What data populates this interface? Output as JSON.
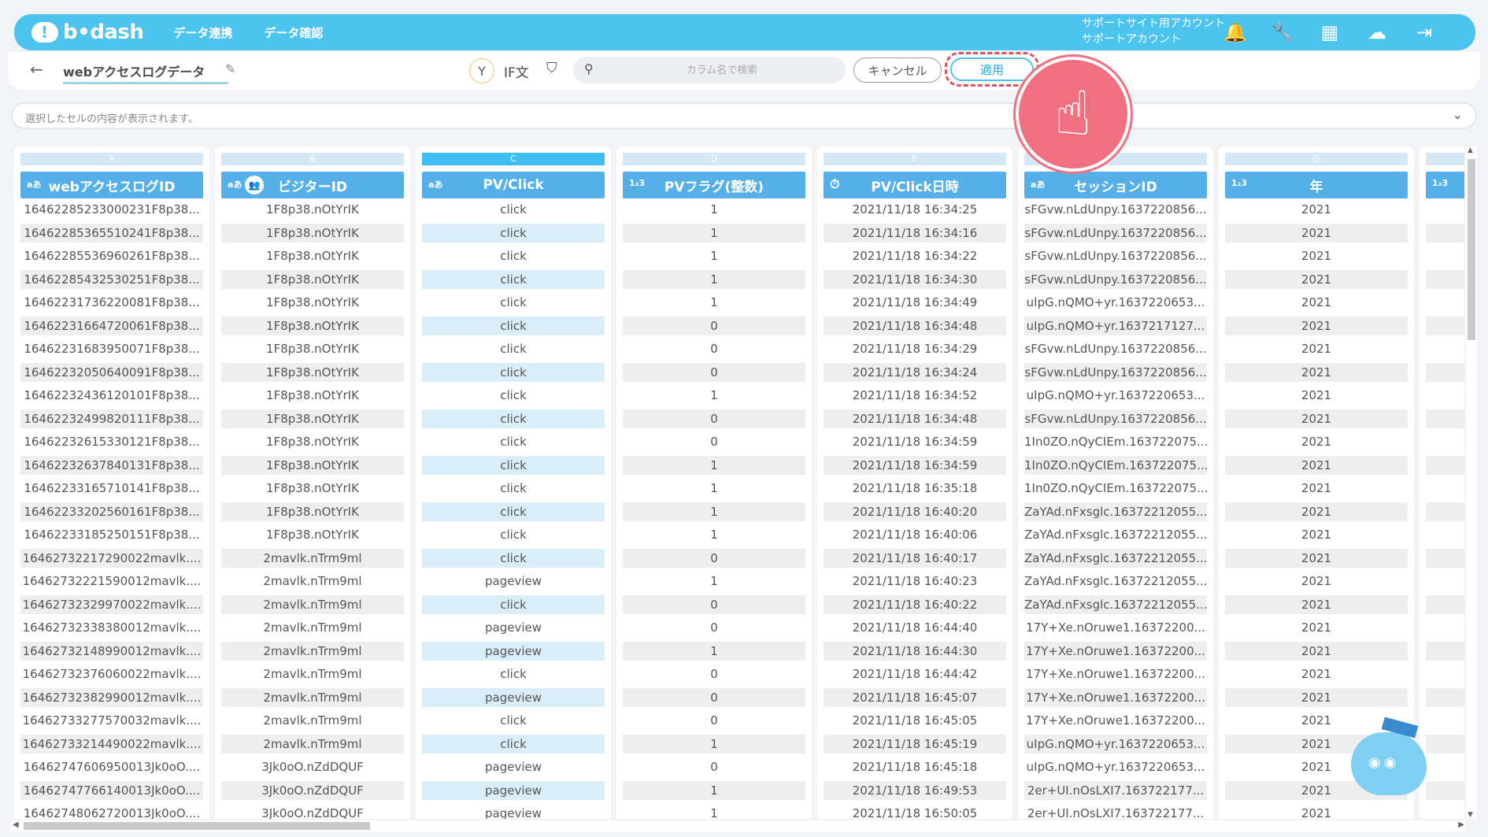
{
  "header": {
    "logo_text": "b•dash",
    "nav": [
      "データ連携",
      "データ確認"
    ],
    "account_line1": "サポートサイト用アカウント",
    "account_line2": "サポートアカウント",
    "icons": [
      "bell-icon",
      "wrench-icon",
      "grid-icon",
      "chat-mascot-icon",
      "logout-icon"
    ]
  },
  "toolbar": {
    "back": "←",
    "table_name": "webアクセスログデータ",
    "if_label": "IF文",
    "search_placeholder": "カラム名で検索",
    "cancel_label": "キャンセル",
    "apply_label": "適用"
  },
  "cell_content": {
    "placeholder": "選択したセルの内容が表示されます。"
  },
  "columns": [
    {
      "letter": "A",
      "name": "webアクセスログID",
      "type": "aあ",
      "user_icon": false
    },
    {
      "letter": "B",
      "name": "ビジターID",
      "type": "aあ",
      "user_icon": true
    },
    {
      "letter": "C",
      "name": "PV/Click",
      "type": "aあ",
      "user_icon": false,
      "active": true
    },
    {
      "letter": "D",
      "name": "PVフラグ(整数)",
      "type": "1₂3",
      "user_icon": false
    },
    {
      "letter": "E",
      "name": "PV/Click日時",
      "type": "⏱",
      "user_icon": false
    },
    {
      "letter": "F",
      "name": "セッションID",
      "type": "aあ",
      "user_icon": false
    },
    {
      "letter": "G",
      "name": "年",
      "type": "1₂3",
      "user_icon": false
    },
    {
      "letter": "",
      "name": "",
      "type": "1₂3",
      "user_icon": false
    }
  ],
  "rows": [
    [
      "16462285233000231F8p38...",
      "1F8p38.nOtYrIK",
      "click",
      "1",
      "2021/11/18 16:34:25",
      "sFGvw.nLdUnpy.1637220856...",
      "2021"
    ],
    [
      "16462285365510241F8p38...",
      "1F8p38.nOtYrIK",
      "click",
      "1",
      "2021/11/18 16:34:16",
      "sFGvw.nLdUnpy.1637220856...",
      "2021"
    ],
    [
      "16462285536960261F8p38...",
      "1F8p38.nOtYrIK",
      "click",
      "1",
      "2021/11/18 16:34:22",
      "sFGvw.nLdUnpy.1637220856...",
      "2021"
    ],
    [
      "16462285432530251F8p38...",
      "1F8p38.nOtYrIK",
      "click",
      "1",
      "2021/11/18 16:34:30",
      "sFGvw.nLdUnpy.1637220856...",
      "2021"
    ],
    [
      "16462231736220081F8p38...",
      "1F8p38.nOtYrIK",
      "click",
      "1",
      "2021/11/18 16:34:49",
      "uIpG.nQMO+yr.1637220653...",
      "2021"
    ],
    [
      "16462231664720061F8p38...",
      "1F8p38.nOtYrIK",
      "click",
      "0",
      "2021/11/18 16:34:48",
      "uIpG.nQMO+yr.1637217127...",
      "2021"
    ],
    [
      "16462231683950071F8p38...",
      "1F8p38.nOtYrIK",
      "click",
      "0",
      "2021/11/18 16:34:29",
      "sFGvw.nLdUnpy.1637220856...",
      "2021"
    ],
    [
      "16462232050640091F8p38...",
      "1F8p38.nOtYrIK",
      "click",
      "0",
      "2021/11/18 16:34:24",
      "sFGvw.nLdUnpy.1637220856...",
      "2021"
    ],
    [
      "16462232436120101F8p38...",
      "1F8p38.nOtYrIK",
      "click",
      "1",
      "2021/11/18 16:34:52",
      "uIpG.nQMO+yr.1637220653...",
      "2021"
    ],
    [
      "16462232499820111F8p38...",
      "1F8p38.nOtYrIK",
      "click",
      "0",
      "2021/11/18 16:34:48",
      "sFGvw.nLdUnpy.1637220856...",
      "2021"
    ],
    [
      "16462232615330121F8p38...",
      "1F8p38.nOtYrIK",
      "click",
      "0",
      "2021/11/18 16:34:59",
      "1In0ZO.nQyCIEm.163722075...",
      "2021"
    ],
    [
      "16462232637840131F8p38...",
      "1F8p38.nOtYrIK",
      "click",
      "1",
      "2021/11/18 16:34:59",
      "1In0ZO.nQyCIEm.163722075...",
      "2021"
    ],
    [
      "16462233165710141F8p38...",
      "1F8p38.nOtYrIK",
      "click",
      "1",
      "2021/11/18 16:35:18",
      "1In0ZO.nQyCIEm.163722075...",
      "2021"
    ],
    [
      "16462233202560161F8p38...",
      "1F8p38.nOtYrIK",
      "click",
      "1",
      "2021/11/18 16:40:20",
      "ZaYAd.nFxsglc.16372212055...",
      "2021"
    ],
    [
      "16462233185250151F8p38...",
      "1F8p38.nOtYrIK",
      "click",
      "1",
      "2021/11/18 16:40:06",
      "ZaYAd.nFxsglc.16372212055...",
      "2021"
    ],
    [
      "16462732217290022mavlk....",
      "2mavlk.nTrm9ml",
      "click",
      "0",
      "2021/11/18 16:40:17",
      "ZaYAd.nFxsglc.16372212055...",
      "2021"
    ],
    [
      "16462732221590012mavlk....",
      "2mavlk.nTrm9ml",
      "pageview",
      "1",
      "2021/11/18 16:40:23",
      "ZaYAd.nFxsglc.16372212055...",
      "2021"
    ],
    [
      "16462732329970022mavlk....",
      "2mavlk.nTrm9ml",
      "click",
      "0",
      "2021/11/18 16:40:22",
      "ZaYAd.nFxsglc.16372212055...",
      "2021"
    ],
    [
      "16462732338380012mavlk....",
      "2mavlk.nTrm9ml",
      "pageview",
      "0",
      "2021/11/18 16:44:40",
      "17Y+Xe.nOruwe1.16372200...",
      "2021"
    ],
    [
      "16462732148990012mavlk....",
      "2mavlk.nTrm9ml",
      "pageview",
      "1",
      "2021/11/18 16:44:30",
      "17Y+Xe.nOruwe1.16372200...",
      "2021"
    ],
    [
      "16462732376060022mavlk....",
      "2mavlk.nTrm9ml",
      "click",
      "0",
      "2021/11/18 16:44:42",
      "17Y+Xe.nOruwe1.16372200...",
      "2021"
    ],
    [
      "16462732382990012mavlk....",
      "2mavlk.nTrm9ml",
      "pageview",
      "0",
      "2021/11/18 16:45:07",
      "17Y+Xe.nOruwe1.16372200...",
      "2021"
    ],
    [
      "16462733277570032mavlk....",
      "2mavlk.nTrm9ml",
      "click",
      "0",
      "2021/11/18 16:45:05",
      "17Y+Xe.nOruwe1.16372200...",
      "2021"
    ],
    [
      "16462733214490022mavlk....",
      "2mavlk.nTrm9ml",
      "click",
      "1",
      "2021/11/18 16:45:19",
      "uIpG.nQMO+yr.1637220653...",
      "2021"
    ],
    [
      "16462747606950013Jk0oO....",
      "3Jk0oO.nZdDQUF",
      "pageview",
      "0",
      "2021/11/18 16:45:18",
      "uIpG.nQMO+yr.1637220653...",
      "2021"
    ],
    [
      "16462747766140013Jk0oO....",
      "3Jk0oO.nZdDQUF",
      "pageview",
      "1",
      "2021/11/18 16:49:53",
      "2er+UI.nOsLXI7.163722177...",
      "2021"
    ],
    [
      "16462748062720013Jk0oO....",
      "3Jk0oO.nZdDQUF",
      "pageview",
      "1",
      "2021/11/18 16:50:05",
      "2er+UI.nOsLXI7.163722177...",
      "2021"
    ]
  ],
  "colors": {
    "brand": "#4dc3f0",
    "header": "#55b0ea",
    "apply_highlight": "#e2505f"
  }
}
